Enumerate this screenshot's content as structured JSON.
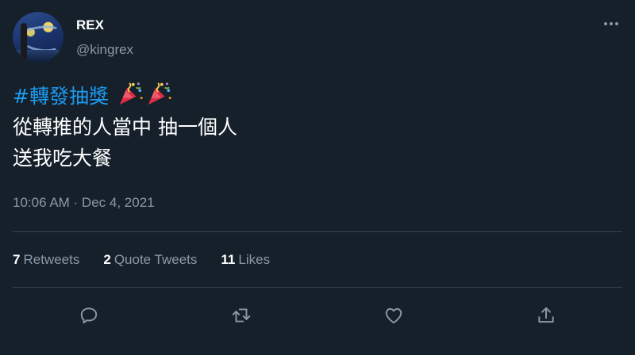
{
  "user": {
    "display_name": "REX",
    "handle": "@kingrex"
  },
  "tweet": {
    "hashtag": "#轉發抽獎",
    "emoji": [
      "party-popper",
      "party-popper"
    ],
    "lines": [
      "從轉推的人當中 抽一個人",
      "送我吃大餐"
    ],
    "timestamp": "10:06 AM · Dec 4, 2021"
  },
  "stats": {
    "retweets": {
      "count": "7",
      "label": "Retweets"
    },
    "quotes": {
      "count": "2",
      "label": "Quote Tweets"
    },
    "likes": {
      "count": "11",
      "label": "Likes"
    }
  },
  "actions": [
    "reply-icon",
    "retweet-icon",
    "like-icon",
    "share-icon"
  ],
  "colors": {
    "background": "#15202b",
    "link": "#1d9bf0",
    "secondary_text": "#8b98a5",
    "divider": "#38444d"
  }
}
